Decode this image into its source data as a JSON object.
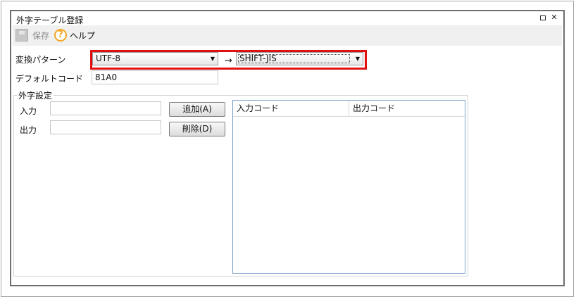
{
  "window": {
    "title": "外字テーブル登録",
    "restore_icon": "restore-icon",
    "close_glyph": "✕"
  },
  "toolbar": {
    "save_label": "保存",
    "help_label": "ヘルプ",
    "save_icon": "floppy-disk-icon",
    "help_icon": "question-circle-icon",
    "help_glyph": "?"
  },
  "form": {
    "pattern_label": "変換パターン",
    "from_encoding": "UTF-8",
    "to_encoding": "SHIFT-JIS",
    "arrow": "→",
    "dropdown_glyph": "▼",
    "default_code_label": "デフォルトコード",
    "default_code_value": "81A0"
  },
  "gaiji": {
    "group_title": "外字設定",
    "input_label": "入力",
    "output_label": "出力",
    "input_value": "",
    "output_value": "",
    "add_button": "追加(A)",
    "delete_button": "削除(D)",
    "columns": [
      "入力コード",
      "出力コード"
    ],
    "rows": []
  },
  "colors": {
    "highlight": "#e01010",
    "help_icon": "#f5a623",
    "list_border": "#7aa0c8"
  }
}
